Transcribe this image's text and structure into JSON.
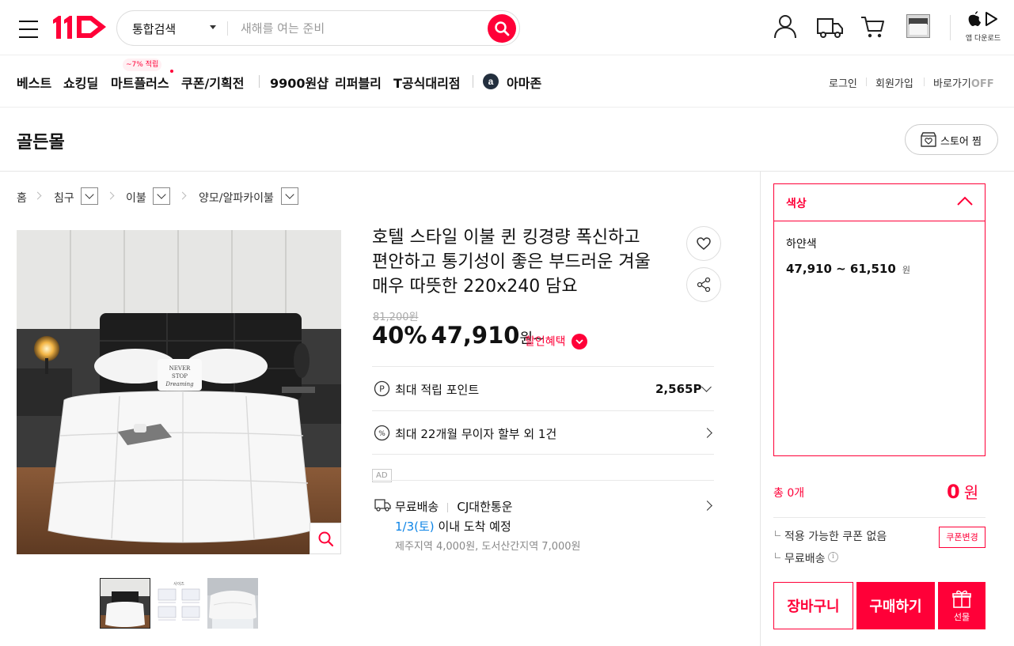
{
  "header": {
    "logo": "11",
    "search_type": "통합검색",
    "search_placeholder": "새해를 여는 준비",
    "app_download": "앱 다운로드"
  },
  "nav": {
    "items": [
      "베스트",
      "쇼킹딜",
      "마트플러스",
      "쿠폰/기획전",
      "9900원샵",
      "리퍼블리",
      "T공식대리점",
      "아마존"
    ],
    "mart_badge": "~7% 적립",
    "util": {
      "login": "로그인",
      "signup": "회원가입",
      "shortcut": "바로가기",
      "shortcut_state": "OFF"
    }
  },
  "store": {
    "name": "골든몰",
    "follow_label": "스토어 찜"
  },
  "breadcrumb": [
    "홈",
    "침구",
    "이불",
    "양모/알파카이불"
  ],
  "product": {
    "title_lines": [
      "호텔 스타일 이불 퀸 킹경량 폭신하고",
      "편안하고 통기성이 좋은 부드러운 겨울",
      "매우 따뜻한 220x240 담요"
    ],
    "original_price": "81,200원",
    "discount": "40%",
    "price": "47,910",
    "price_unit": "원~",
    "benefit_label": "할인혜택",
    "points_label": "최대 적립 포인트",
    "points_value": "2,565P",
    "installment_label": "최대 22개월 무이자 할부 외 1건",
    "ad_badge": "AD",
    "shipping_label": "무료배송",
    "courier": "CJ대한통운",
    "delivery_date": "1/3(토)",
    "delivery_suffix": "이내 도착 예정",
    "extra_fee": "제주지역 4,000원, 도서산간지역 7,000원",
    "pillow_text": [
      "NEVER",
      "STOP",
      "Dreaming"
    ]
  },
  "thumbnail_label": "사이즈",
  "sidebar": {
    "option_title": "색상",
    "option_name": "하얀색",
    "option_price": "47,910 ~ 61,510",
    "option_price_unit": "원",
    "total_label": "총 0개",
    "total_price": "0",
    "total_unit": "원",
    "coupon_text": "적용 가능한 쿠폰 없음",
    "coupon_change": "쿠폰변경",
    "free_shipping": "무료배송",
    "cart_button": "장바구니",
    "buy_button": "구매하기",
    "gift_button": "선물"
  },
  "colors": {
    "accent": "#ff0038",
    "delivery_blue": "#0b83e6"
  }
}
